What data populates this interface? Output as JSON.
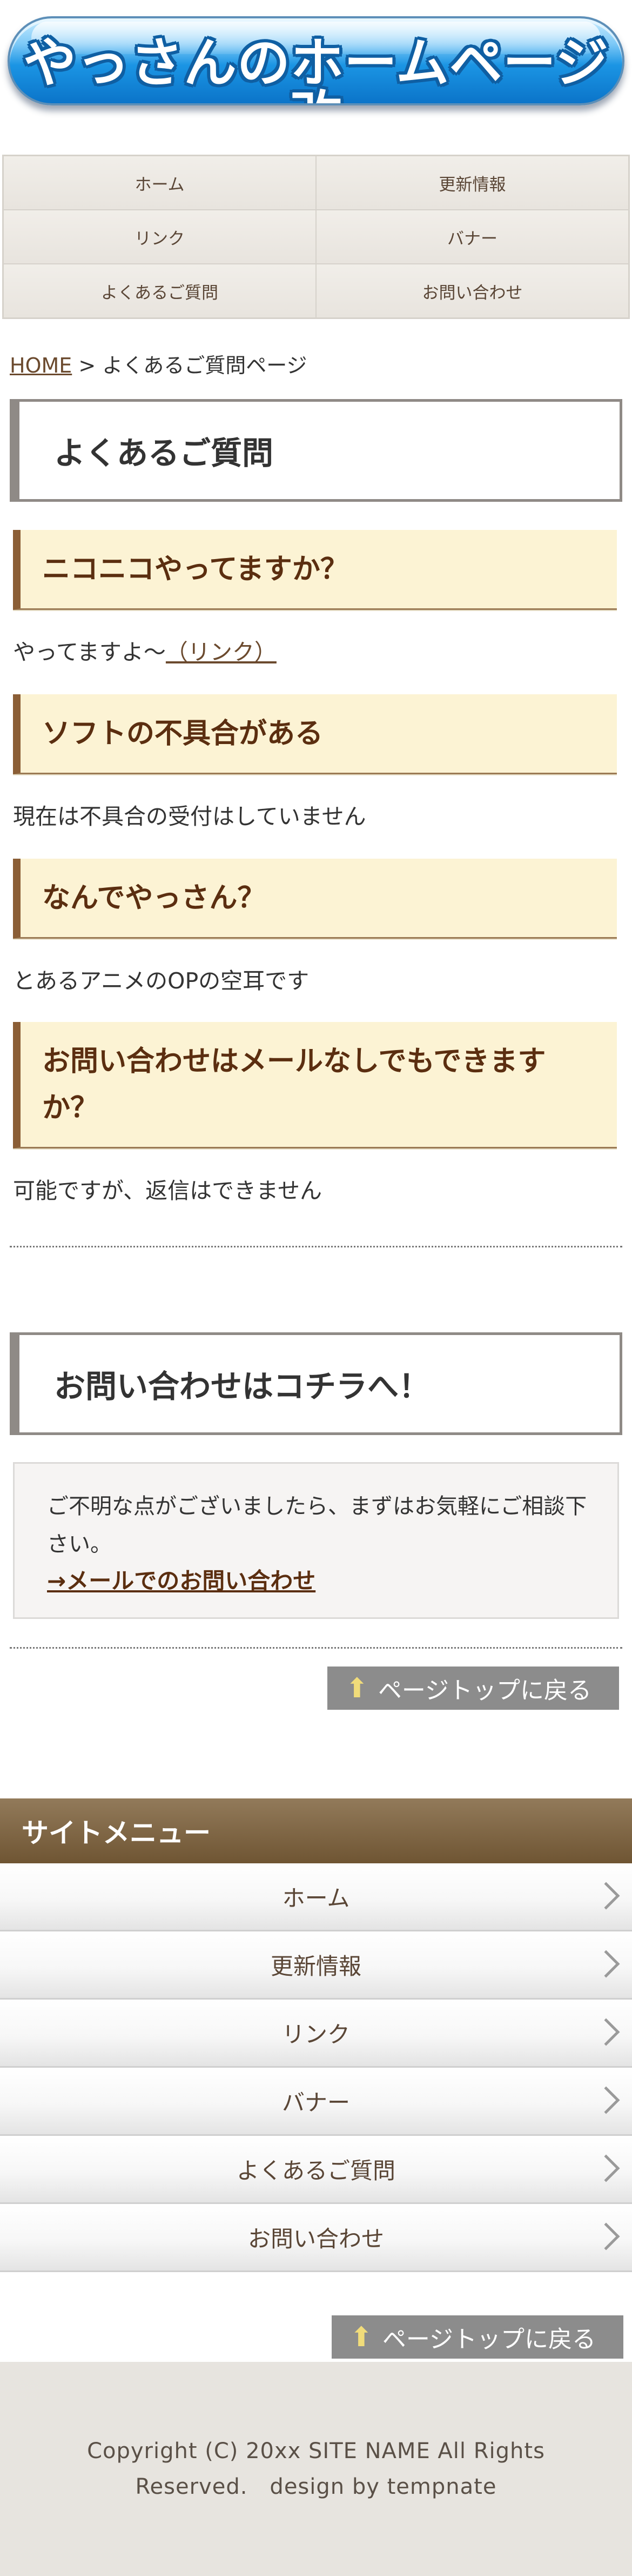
{
  "logo": {
    "text": "やっさんのホームページ改"
  },
  "gnav": {
    "items": [
      {
        "label": "ホーム"
      },
      {
        "label": "更新情報"
      },
      {
        "label": "リンク"
      },
      {
        "label": "バナー"
      },
      {
        "label": "よくあるご質問"
      },
      {
        "label": "お問い合わせ"
      }
    ]
  },
  "breadcrumb": {
    "home": "HOME",
    "separator": " > ",
    "current": "よくあるご質問ページ"
  },
  "page_title": "よくあるご質問",
  "faq": [
    {
      "question": "ニコニコやってますか？",
      "answer": "やってますよ～",
      "link": "（リンク）"
    },
    {
      "question": "ソフトの不具合がある",
      "answer": "現在は不具合の受付はしていません"
    },
    {
      "question": "なんでやっさん？",
      "answer": "とあるアニメのOPの空耳です"
    },
    {
      "question": "お問い合わせはメールなしでもできますか？",
      "answer": "可能ですが、返信はできません"
    }
  ],
  "contact": {
    "title": "お問い合わせはコチラへ！",
    "text": "ご不明な点がございましたら、まずはお気軽にご相談下さい。",
    "link": "→メールでのお問い合わせ"
  },
  "pagetop": {
    "label": "ページトップに戻る",
    "icon": "up-arrow-icon"
  },
  "sitemenu": {
    "title": "サイトメニュー",
    "items": [
      {
        "label": "ホーム"
      },
      {
        "label": "更新情報"
      },
      {
        "label": "リンク"
      },
      {
        "label": "バナー"
      },
      {
        "label": "よくあるご質問"
      },
      {
        "label": "お問い合わせ"
      }
    ]
  },
  "footer": {
    "copyright": "Copyright (C) 20xx SITE NAME All Rights Reserved.　design by tempnate"
  },
  "colors": {
    "accent": "#8b5e36",
    "question_bg": "#fcf3d4",
    "question_text": "#5b2e10",
    "menu_header": "#7f6644",
    "pagetop_bg": "#8c8c8c",
    "footer_bg": "#e7e4df"
  }
}
